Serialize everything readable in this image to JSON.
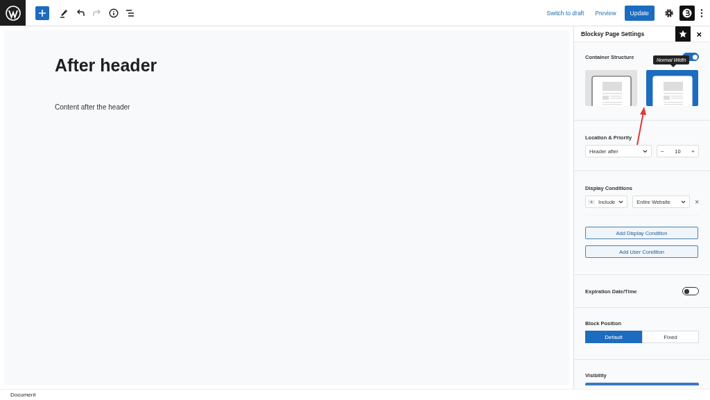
{
  "top_bar": {
    "switch_to_draft": "Switch to draft",
    "preview": "Preview",
    "update": "Update",
    "inserter_active": true
  },
  "editor": {
    "title": "After header",
    "paragraph": "Content after the header"
  },
  "sidebar": {
    "title": "Blocksy Page Settings",
    "close": "×",
    "sections": [
      {
        "kind": "layout",
        "label": "Container Structure",
        "on": true,
        "tooltip": "Normal Width",
        "options": [
          {
            "selected": false
          },
          {
            "selected": true
          }
        ]
      },
      {
        "kind": "location",
        "label": "Location & Priority",
        "select": "Header after",
        "minus": "−",
        "number": "10",
        "plus": "+"
      },
      {
        "kind": "conditions",
        "label": "Display Conditions",
        "prefix": "+",
        "rule_type": "Include",
        "target": "Entire Website",
        "remove": "×",
        "buttons": [
          "Add Display Condition",
          "Add User Condition"
        ]
      },
      {
        "kind": "toggle",
        "label": "Expiration Date/Time",
        "on": false
      },
      {
        "kind": "segmented",
        "label": "Block Position",
        "options": [
          {
            "label": "Default",
            "selected": true
          },
          {
            "label": "Fixed",
            "selected": false
          }
        ]
      },
      {
        "kind": "heading",
        "label": "Visibility"
      }
    ]
  },
  "status_bar": {
    "breadcrumb": "Document"
  }
}
